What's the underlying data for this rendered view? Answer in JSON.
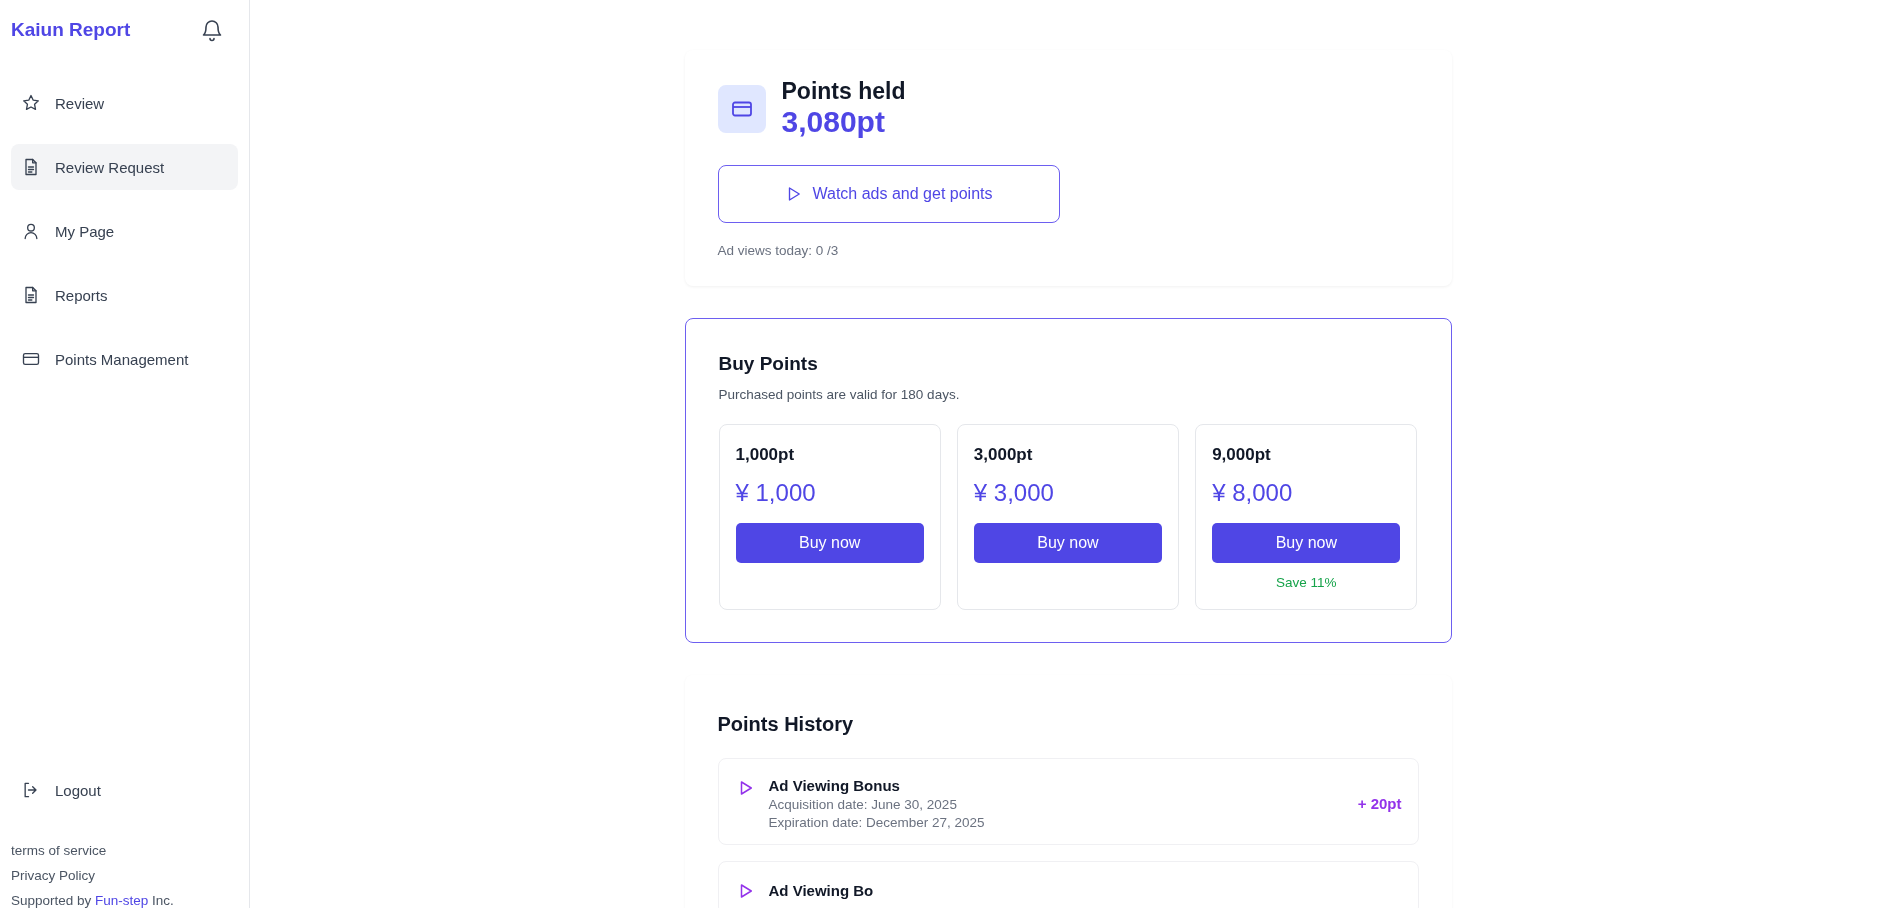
{
  "sidebar": {
    "logo": "Kaiun Report",
    "nav": [
      {
        "label": "Review",
        "kind": "star",
        "selected": false
      },
      {
        "label": "Review Request",
        "kind": "document",
        "selected": true
      },
      {
        "label": "My Page",
        "kind": "user",
        "selected": false
      },
      {
        "label": "Reports",
        "kind": "document",
        "selected": false
      },
      {
        "label": "Points Management",
        "kind": "card",
        "selected": false
      }
    ],
    "logout": "Logout",
    "footer_links": [
      "terms of service",
      "Privacy Policy"
    ],
    "supported": {
      "before": "Supported by ",
      "link": "Fun-step",
      "after": " Inc."
    }
  },
  "points": {
    "title": "Points held",
    "value": "3,080pt",
    "watch_button": "Watch ads and get points",
    "ad_views": "Ad views today: 0 /3"
  },
  "buy": {
    "title": "Buy Points",
    "note": "Purchased points are valid for 180 days.",
    "plans": [
      {
        "amount": "1,000pt",
        "price": "¥ 1,000",
        "button": "Buy now"
      },
      {
        "amount": "3,000pt",
        "price": "¥ 3,000",
        "button": "Buy now"
      },
      {
        "amount": "9,000pt",
        "price": "¥ 8,000",
        "button": "Buy now",
        "saving": "Save 11%"
      }
    ]
  },
  "history": {
    "title": "Points History",
    "items": [
      {
        "kind": "play",
        "title": "Ad Viewing Bonus",
        "acquisition": "Acquisition date: June 30, 2025",
        "expiration": "Expiration date: December 27, 2025",
        "amount": "+ 20pt"
      },
      {
        "kind": "play",
        "title": "Ad Viewing Bo"
      }
    ]
  }
}
